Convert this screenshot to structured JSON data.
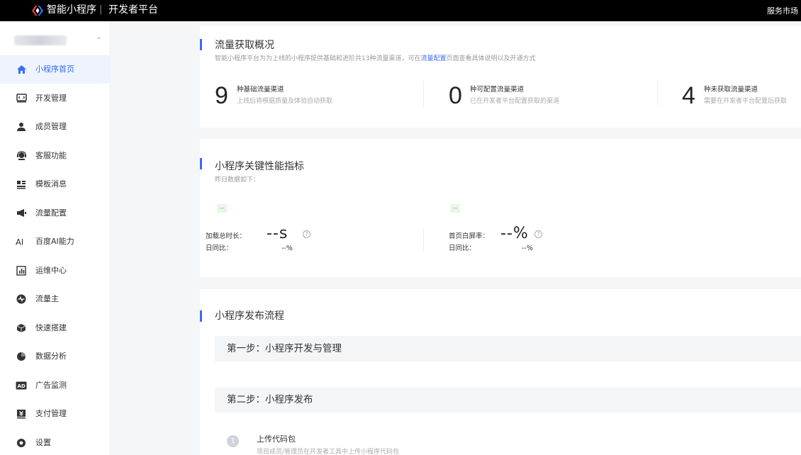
{
  "topbar": {
    "brand": "智能小程序",
    "separator": "|",
    "platform": "开发者平台",
    "right_link": "服务市场"
  },
  "sidebar": {
    "items": [
      {
        "label": "小程序首页",
        "icon": "home-icon"
      },
      {
        "label": "开发管理",
        "icon": "code-icon"
      },
      {
        "label": "成员管理",
        "icon": "user-icon"
      },
      {
        "label": "客服功能",
        "icon": "headset-icon"
      },
      {
        "label": "模板消息",
        "icon": "template-icon"
      },
      {
        "label": "流量配置",
        "icon": "megaphone-icon"
      },
      {
        "label": "百度AI能力",
        "icon": "ai-icon"
      },
      {
        "label": "运维中心",
        "icon": "chart-icon"
      },
      {
        "label": "流量主",
        "icon": "pulse-icon"
      },
      {
        "label": "快速搭建",
        "icon": "cube-icon"
      },
      {
        "label": "数据分析",
        "icon": "pie-icon"
      },
      {
        "label": "广告监测",
        "icon": "ad-icon"
      },
      {
        "label": "支付管理",
        "icon": "payment-icon"
      },
      {
        "label": "设置",
        "icon": "gear-icon"
      }
    ],
    "active_index": 0,
    "accent": "#3a6cf6"
  },
  "traffic": {
    "title": "流量获取概况",
    "desc_prefix": "智能小程序平台为为上线的小程序提供基础和进阶共13种流量渠道，可在",
    "desc_link": "流量配置",
    "desc_suffix": "页面查看具体说明以及开通方式",
    "stats": [
      {
        "value": "9",
        "title": "种基础流量渠道",
        "desc": "上线后将根据质量及体验自动获取"
      },
      {
        "value": "0",
        "title": "种可配置流量渠道",
        "desc": "已在开发者平台配置获取的渠道"
      },
      {
        "value": "4",
        "title": "种未获取流量渠道",
        "desc": "需要在开发者平台配置后获取"
      }
    ]
  },
  "perf": {
    "title": "小程序关键性能指标",
    "desc": "昨日数据如下：",
    "metrics": [
      {
        "tag": "--",
        "label": "加载总时长：",
        "value": "--s",
        "sub_label": "日同比：",
        "sub_value": "--%"
      },
      {
        "tag": "--",
        "label": "首页白屏率：",
        "value": "--%",
        "sub_label": "日同比：",
        "sub_value": "--%"
      }
    ]
  },
  "publish": {
    "title": "小程序发布流程",
    "step1": "第一步：小程序开发与管理",
    "step2": "第二步：小程序发布",
    "sub_steps": [
      {
        "num": "1",
        "title": "上传代码包",
        "desc": "项目成员/管理员在开发者工具中上传小程序代码包"
      }
    ]
  }
}
